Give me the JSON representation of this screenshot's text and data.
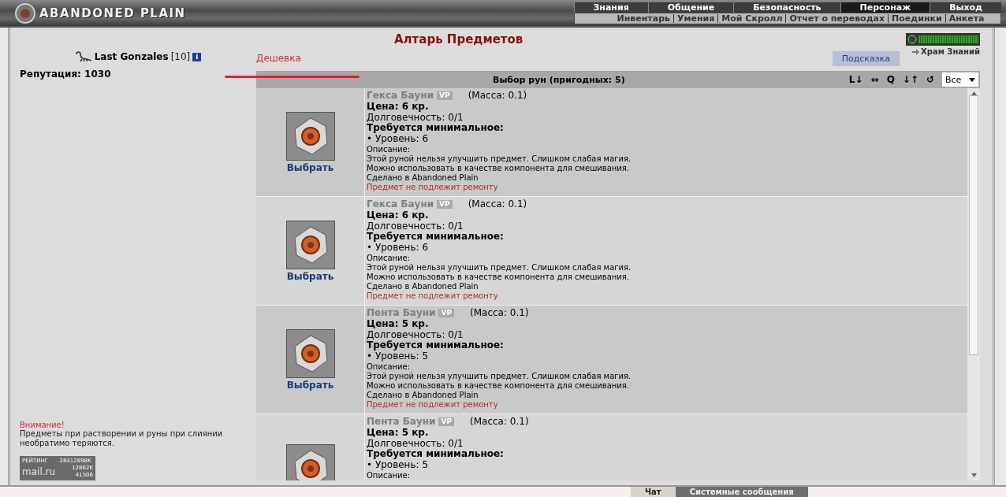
{
  "header": {
    "logo": "ABANDONED PLAIN",
    "nav": [
      {
        "label": "Знания",
        "selected": false
      },
      {
        "label": "Общение",
        "selected": false
      },
      {
        "label": "Безопасность",
        "selected": false
      },
      {
        "label": "Персонаж",
        "selected": true
      },
      {
        "label": "Выход",
        "selected": false
      }
    ],
    "subnav": [
      "Инвентарь",
      "Умения",
      "Мой Скролл",
      "Отчет о переводах",
      "Поединки",
      "Анкета"
    ]
  },
  "player": {
    "name": "Last Gonzales",
    "level": "[10]",
    "info": "i",
    "reputation": "Репутация: 1030"
  },
  "warning": {
    "title": "Внимание!",
    "text": "Предметы при растворении и руны при слиянии необратимо теряются."
  },
  "counter": {
    "label": "РЕЙТИНГ",
    "total": "28412898K",
    "brand": "mail.ru",
    "line_1": "12862K",
    "line_2": "41506"
  },
  "page_title": "Алтарь Предметов",
  "filter_label": "Дешевка",
  "hint_button": "Подсказка",
  "temple": {
    "label": "Храм Знаний",
    "level": 1
  },
  "panel": {
    "title": "Выбор рун (пригодных: 5)",
    "tools": [
      "L↓",
      "⇔",
      "Q",
      "↓↑",
      "↺"
    ],
    "filter": "Все"
  },
  "items": [
    {
      "name": "Гекса Бауни",
      "badge": "VP",
      "mass": "(Масса: 0.1)",
      "price": "Цена: 6 кр.",
      "durability": "Долговечность: 0/1",
      "requires": "Требуется минимальное:",
      "level": "• Уровень: 6",
      "desc_label": "Описание:",
      "description": [
        "Этой руной нельзя улучшить предмет. Слишком слабая магия.",
        "Можно использовать в качестве компонента для смешивания.",
        "Сделано в Abandoned Plain"
      ],
      "note": "Предмет не подлежит ремонту",
      "action": "Выбрать"
    },
    {
      "name": "Гекса Бауни",
      "badge": "VP",
      "mass": "(Масса: 0.1)",
      "price": "Цена: 6 кр.",
      "durability": "Долговечность: 0/1",
      "requires": "Требуется минимальное:",
      "level": "• Уровень: 6",
      "desc_label": "Описание:",
      "description": [
        "Этой руной нельзя улучшить предмет. Слишком слабая магия.",
        "Можно использовать в качестве компонента для смешивания.",
        "Сделано в Abandoned Plain"
      ],
      "note": "Предмет не подлежит ремонту",
      "action": "Выбрать"
    },
    {
      "name": "Пента Бауни",
      "badge": "VP",
      "mass": "(Масса: 0.1)",
      "price": "Цена: 5 кр.",
      "durability": "Долговечность: 0/1",
      "requires": "Требуется минимальное:",
      "level": "• Уровень: 5",
      "desc_label": "Описание:",
      "description": [
        "Этой руной нельзя улучшить предмет. Слишком слабая магия.",
        "Можно использовать в качестве компонента для смешивания.",
        "Сделано в Abandoned Plain"
      ],
      "note": "Предмет не подлежит ремонту",
      "action": "Выбрать"
    },
    {
      "name": "Пента Бауни",
      "badge": "VP",
      "mass": "(Масса: 0.1)",
      "price": "Цена: 5 кр.",
      "durability": "Долговечность: 0/1",
      "requires": "Требуется минимальное:",
      "level": "• Уровень: 5",
      "desc_label": "Описание:"
    }
  ],
  "chat_tabs": [
    {
      "label": "Чат",
      "selected": true
    },
    {
      "label": "Системные сообщения",
      "selected": false
    }
  ]
}
